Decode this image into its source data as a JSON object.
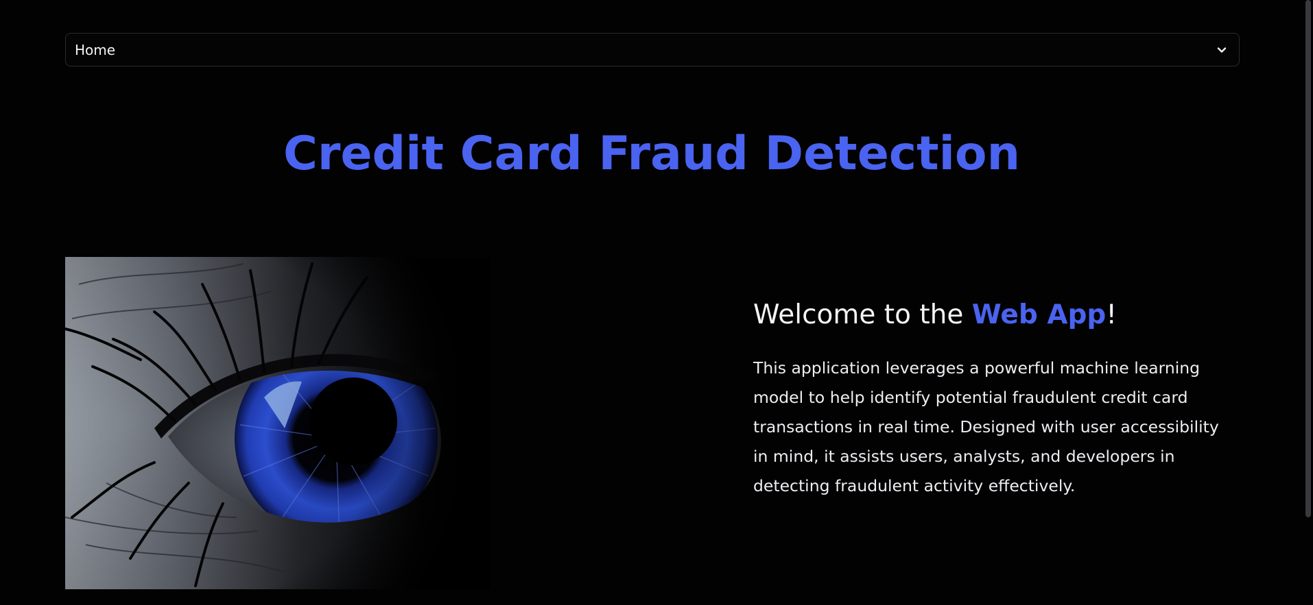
{
  "theme": {
    "accent": "#4a63f0",
    "background": "#020203",
    "text": "#f4f4f6"
  },
  "nav": {
    "selected": "Home",
    "icon": "chevron-down-icon"
  },
  "title": "Credit Card Fraud Detection",
  "hero_image": {
    "description_icon": "blue-eye-image"
  },
  "welcome": {
    "prefix": "Welcome to the ",
    "highlight": "Web App",
    "suffix": "!",
    "body": "This application leverages a powerful machine learning model to help identify potential fraudulent credit card transactions in real time. Designed with user accessibility in mind, it assists users, analysts, and developers in detecting fraudulent activity effectively."
  }
}
